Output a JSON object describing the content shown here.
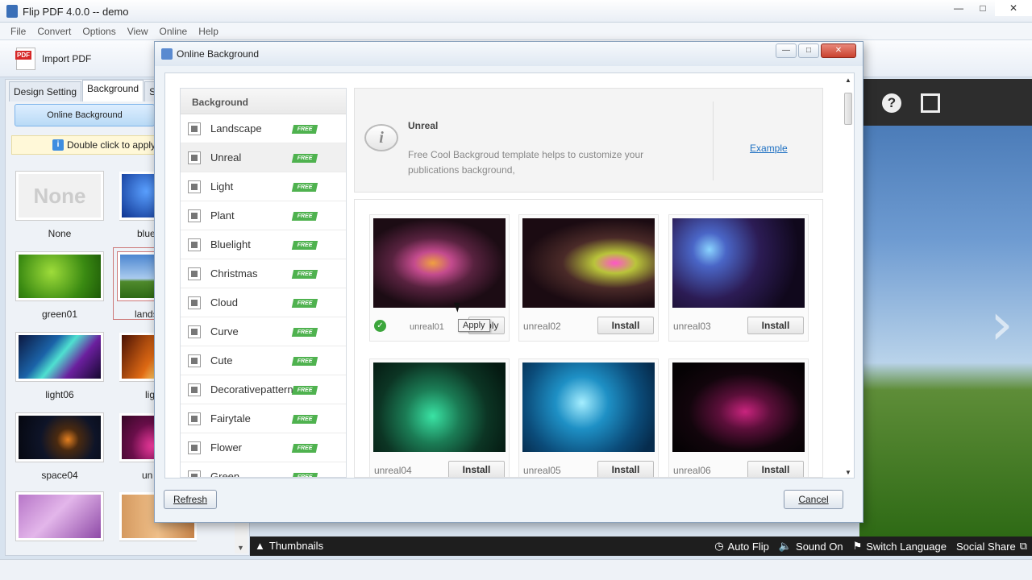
{
  "app": {
    "title": "Flip PDF 4.0.0  -- demo",
    "menu": [
      "File",
      "Convert",
      "Options",
      "View",
      "Online",
      "Help"
    ],
    "toolbar": {
      "import_label": "Import PDF"
    }
  },
  "left_panel": {
    "tabs": [
      "Design Setting",
      "Background",
      "Scen"
    ],
    "active_tab": "Background",
    "online_bg_button": "Online Background",
    "hint": "Double click to apply the",
    "thumbnails": [
      {
        "label": "None",
        "none_text": "None"
      },
      {
        "label": "blue"
      },
      {
        "label": "green01"
      },
      {
        "label": "lands"
      },
      {
        "label": "light06"
      },
      {
        "label": "lig"
      },
      {
        "label": "space04"
      },
      {
        "label": "un"
      },
      {
        "label": ""
      },
      {
        "label": ""
      }
    ]
  },
  "preview": {
    "bottom_bar": {
      "thumbnails": "Thumbnails",
      "auto_flip": "Auto Flip",
      "sound": "Sound On",
      "language": "Switch Language",
      "share": "Social Share"
    }
  },
  "dialog": {
    "title": "Online Background",
    "categories_header": "Background",
    "free_badge": "FREE",
    "categories": [
      "Landscape",
      "Unreal",
      "Light",
      "Plant",
      "Bluelight",
      "Christmas",
      "Cloud",
      "Curve",
      "Cute",
      "Decorativepattern",
      "Fairytale",
      "Flower",
      "Green"
    ],
    "selected_category": "Unreal",
    "info": {
      "name": "Unreal",
      "description": "Free Cool Backgroud template helps to customize your publications background,",
      "example_link": "Example"
    },
    "templates": [
      {
        "name": "unreal01",
        "button": "Apply",
        "applied": true
      },
      {
        "name": "unreal02",
        "button": "Install",
        "applied": false
      },
      {
        "name": "unreal03",
        "button": "Install",
        "applied": false
      },
      {
        "name": "unreal04",
        "button": "Install",
        "applied": false
      },
      {
        "name": "unreal05",
        "button": "Install",
        "applied": false
      },
      {
        "name": "unreal06",
        "button": "Install",
        "applied": false
      }
    ],
    "tooltip": "Apply",
    "buttons": {
      "refresh": "Refresh",
      "cancel": "Cancel"
    }
  }
}
